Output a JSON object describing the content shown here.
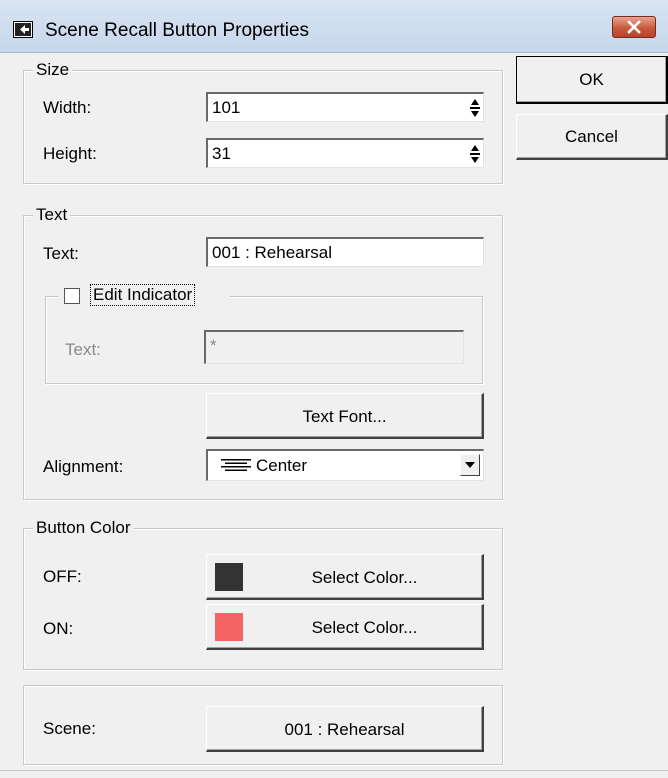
{
  "window": {
    "title": "Scene Recall Button Properties"
  },
  "size": {
    "group_label": "Size",
    "width_label": "Width:",
    "width_value": "101",
    "height_label": "Height:",
    "height_value": "31"
  },
  "text_group": {
    "group_label": "Text",
    "text_label": "Text:",
    "text_value": "001 : Rehearsal",
    "edit_indicator": {
      "label": "Edit Indicator",
      "checked": false,
      "text_label": "Text:",
      "text_value": "*"
    },
    "text_font_button": "Text Font...",
    "alignment_label": "Alignment:",
    "alignment_value": "Center"
  },
  "button_color": {
    "group_label": "Button Color",
    "off_label": "OFF:",
    "off_color": "#333333",
    "off_button": "Select Color...",
    "on_label": "ON:",
    "on_color": "#f56464",
    "on_button": "Select Color..."
  },
  "scene": {
    "label": "Scene:",
    "button": "001 : Rehearsal"
  },
  "actions": {
    "ok": "OK",
    "cancel": "Cancel"
  }
}
